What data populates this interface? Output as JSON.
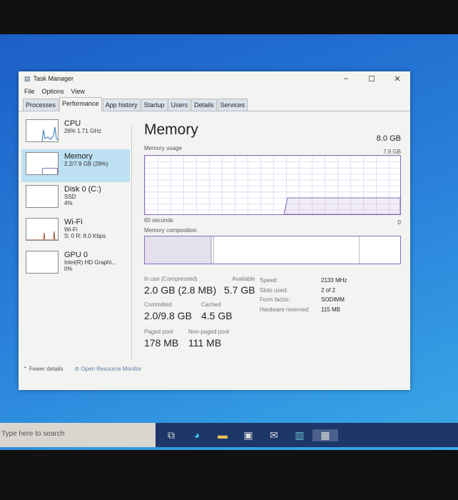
{
  "window": {
    "title": "Task Manager",
    "menu": [
      "File",
      "Options",
      "View"
    ],
    "tabs": [
      "Processes",
      "Performance",
      "App history",
      "Startup",
      "Users",
      "Details",
      "Services"
    ],
    "active_tab": "Performance"
  },
  "sidebar": [
    {
      "name": "CPU",
      "line1": "26% 1.71 GHz",
      "line2": ""
    },
    {
      "name": "Memory",
      "line1": "2.2/7.9 GB (28%)",
      "line2": ""
    },
    {
      "name": "Disk 0 (C:)",
      "line1": "SSD",
      "line2": "4%"
    },
    {
      "name": "Wi-Fi",
      "line1": "Wi-Fi",
      "line2": "S: 0 R: 8.0 Kbps"
    },
    {
      "name": "GPU 0",
      "line1": "Intel(R) HD Graphi...",
      "line2": "0%"
    }
  ],
  "main": {
    "title": "Memory",
    "total": "8.0 GB",
    "usage_label": "Memory usage",
    "usage_max": "7.9 GB",
    "time_label": "60 seconds",
    "zero": "0",
    "composition_label": "Memory composition",
    "usage_fraction": 0.28,
    "stats": {
      "in_use_label": "In use (Compressed)",
      "in_use": "2.0 GB (2.8 MB)",
      "available_label": "Available",
      "available": "5.7 GB",
      "committed_label": "Committed",
      "committed": "2.0/9.8 GB",
      "cached_label": "Cached",
      "cached": "4.5 GB",
      "paged_label": "Paged pool",
      "paged": "178 MB",
      "nonpaged_label": "Non-paged pool",
      "nonpaged": "111 MB"
    },
    "hw": [
      {
        "k": "Speed:",
        "v": "2133 MHz"
      },
      {
        "k": "Slots used:",
        "v": "2 of 2"
      },
      {
        "k": "Form factor:",
        "v": "SODIMM"
      },
      {
        "k": "Hardware reserved:",
        "v": "115 MB"
      }
    ]
  },
  "footer": {
    "fewer": "Fewer details",
    "monitor": "Open Resource Monitor"
  },
  "taskbar": {
    "search_placeholder": "Type here to search"
  },
  "colors": {
    "accent": "#8a6dbf",
    "selected": "#bde0f3"
  }
}
